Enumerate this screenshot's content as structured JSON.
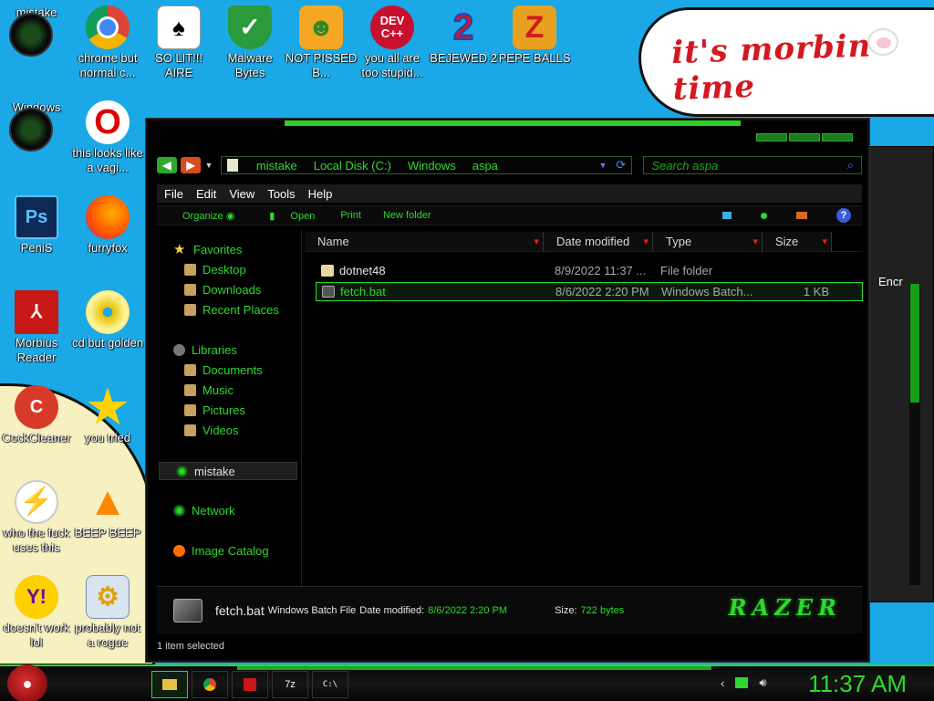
{
  "wallpaper": {
    "caption": "it's morbin time"
  },
  "desktop_icons": [
    {
      "label": "mistake",
      "icon": "razer-icon"
    },
    {
      "label": "chrome but normal c...",
      "icon": "chrome-icon"
    },
    {
      "label": "SO LIT!!! AIRE",
      "icon": "solitaire-icon"
    },
    {
      "label": "Malware Bytes",
      "icon": "shield-icon"
    },
    {
      "label": "NOT PISSED B...",
      "icon": "angry-pig-icon"
    },
    {
      "label": "you all are too stupid...",
      "icon": "devcpp-icon",
      "icon_text": "DEV C++"
    },
    {
      "label": "BEJEWED 2",
      "icon": "bejeweled-icon"
    },
    {
      "label": "PEPE BALLS",
      "icon": "pepe-icon"
    },
    {
      "label": "Windows Vista",
      "icon": "razer-icon"
    },
    {
      "label": "this looks like a vagi...",
      "icon": "opera-icon"
    },
    {
      "label": "PeniS",
      "icon": "photoshop-icon",
      "icon_text": "Ps"
    },
    {
      "label": "furryfox",
      "icon": "firefox-icon"
    },
    {
      "label": "Morbius Reader",
      "icon": "pdf-icon"
    },
    {
      "label": "cd but golden",
      "icon": "cd-icon"
    },
    {
      "label": "CockCleaner",
      "icon": "ccleaner-icon"
    },
    {
      "label": "you tried",
      "icon": "star-icon"
    },
    {
      "label": "who the fuck uses this",
      "icon": "avast-icon"
    },
    {
      "label": "BEEP BEEP",
      "icon": "vlc-icon"
    },
    {
      "label": "doesn't work lol",
      "icon": "yahoo-icon"
    },
    {
      "label": "probably not a rogue",
      "icon": "gear-icon"
    }
  ],
  "explorer": {
    "breadcrumb": [
      "mistake",
      "Local Disk (C:)",
      "Windows",
      "aspa"
    ],
    "search_placeholder": "Search aspa",
    "menu": [
      "File",
      "Edit",
      "View",
      "Tools",
      "Help"
    ],
    "toolbar": {
      "organize": "Organize",
      "open": "Open",
      "print": "Print",
      "new_folder": "New folder"
    },
    "sidebar": {
      "favorites_label": "Favorites",
      "favorites": [
        "Desktop",
        "Downloads",
        "Recent Places"
      ],
      "libraries_label": "Libraries",
      "libraries": [
        "Documents",
        "Music",
        "Pictures",
        "Videos"
      ],
      "selected": "mistake",
      "network": "Network",
      "image_catalog": "Image Catalog"
    },
    "columns": {
      "name": "Name",
      "date": "Date modified",
      "type": "Type",
      "size": "Size"
    },
    "files": [
      {
        "name": "dotnet48",
        "date": "8/9/2022 11:37 ...",
        "type": "File folder",
        "size": "",
        "selected": false
      },
      {
        "name": "fetch.bat",
        "date": "8/6/2022 2:20 PM",
        "type": "Windows Batch...",
        "size": "1 KB",
        "selected": true
      }
    ],
    "details": {
      "filename": "fetch.bat",
      "filetype": "Windows Batch File",
      "date_label": "Date modified:",
      "date_value": "8/6/2022 2:20 PM",
      "size_label": "Size:",
      "size_value": "722 bytes",
      "brand": "RAZER"
    },
    "status": "1 item selected"
  },
  "background_window": {
    "column_label": "Encr"
  },
  "taskbar": {
    "clock": "11:37 AM",
    "buttons": [
      "explorer-icon",
      "chrome-icon",
      "pdf-icon",
      "7zip-icon",
      "cmd-icon"
    ],
    "zip_text": "7z",
    "cmd_text": "C:\\"
  }
}
